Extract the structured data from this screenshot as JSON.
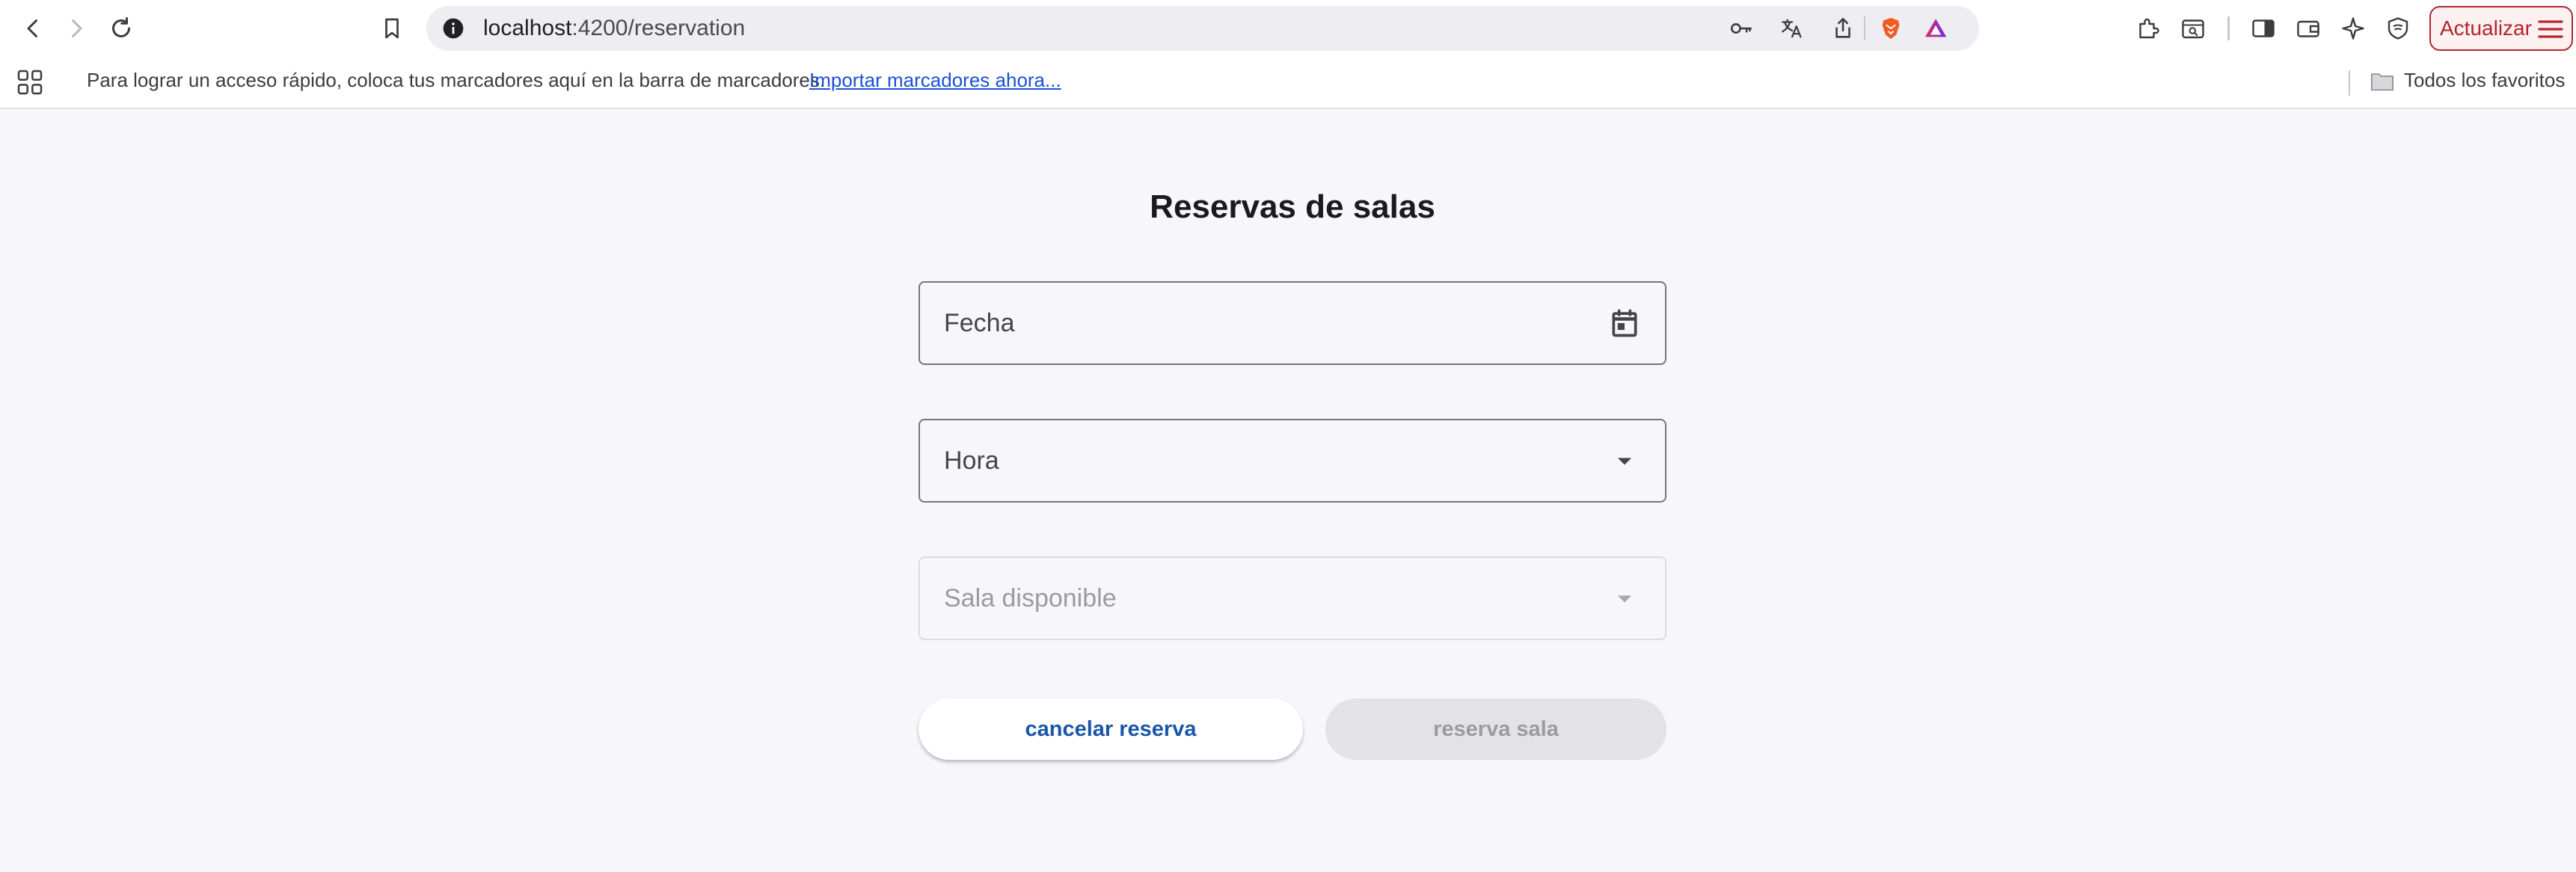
{
  "browser": {
    "url_host": "localhost",
    "url_rest": ":4200/reservation",
    "update_label": "Actualizar",
    "icons": {
      "back": "arrow-left-icon",
      "forward": "arrow-right-icon",
      "reload": "reload-icon",
      "bookmark": "bookmark-icon",
      "site_info": "info-icon",
      "password": "key-icon",
      "translate": "translate-icon",
      "share": "share-icon",
      "brave_shields": "brave-lion-icon",
      "rewards": "triangle-icon",
      "extensions": "puzzle-icon",
      "search_tabs": "search-tab-icon",
      "sidebar": "sidebar-icon",
      "wallet": "wallet-icon",
      "leo": "sparkle-icon",
      "vpn": "shield-icon",
      "menu": "hamburger-icon"
    }
  },
  "bookmarks_bar": {
    "message": "Para lograr un acceso rápido, coloca tus marcadores aquí en la barra de marcadores.",
    "import_link": "Importar marcadores ahora...",
    "all_bookmarks": "Todos los favoritos"
  },
  "form": {
    "title": "Reservas de salas",
    "date_label": "Fecha",
    "time_label": "Hora",
    "room_label": "Sala disponible",
    "cancel_button": "cancelar reserva",
    "reserve_button": "reserva sala"
  },
  "colors": {
    "accent": "#1a56a8",
    "update_red": "#b3262e",
    "link": "#1a4fd6",
    "page_bg": "#f7f6fb"
  }
}
